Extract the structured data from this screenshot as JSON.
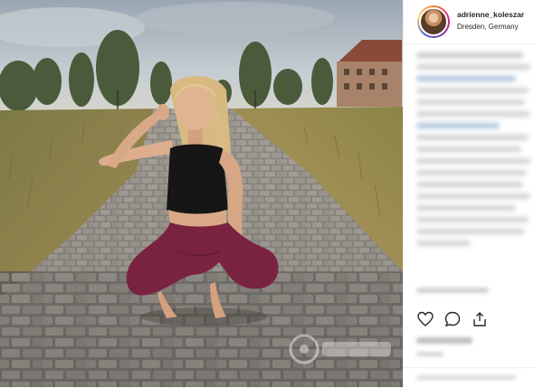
{
  "post": {
    "username": "adrienne_koleszar",
    "location": "Dresden, Germany"
  },
  "icons": {
    "like": "heart-icon",
    "comment": "comment-icon",
    "share": "share-icon"
  },
  "colors": {
    "sky": "#b8c3cc",
    "grass": "#9b8a52",
    "cobblestone": "#8d8983",
    "leggings": "#7a2340",
    "top": "#161616",
    "hair": "#d9bb86"
  }
}
